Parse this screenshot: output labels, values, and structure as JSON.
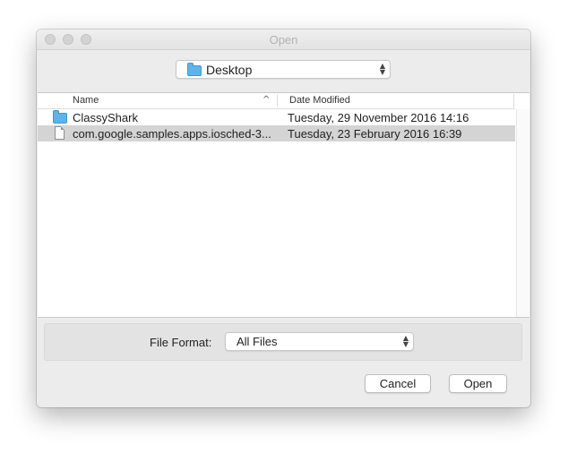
{
  "window": {
    "title": "Open"
  },
  "location": {
    "selected": "Desktop",
    "icon": "folder-icon"
  },
  "columns": {
    "name": "Name",
    "date_modified": "Date Modified",
    "sort_indicator": "^"
  },
  "files": [
    {
      "name": "ClassyShark",
      "date": "Tuesday, 29 November 2016 14:16",
      "icon": "folder-icon",
      "selected": false
    },
    {
      "name": "com.google.samples.apps.iosched-3...",
      "date": "Tuesday, 23 February 2016 16:39",
      "icon": "document-icon",
      "selected": true
    }
  ],
  "format": {
    "label": "File Format:",
    "selected": "All Files"
  },
  "buttons": {
    "cancel": "Cancel",
    "open": "Open"
  },
  "colors": {
    "folder": "#5fb3ea",
    "selection": "#d4d4d4",
    "window_background": "#ececec"
  }
}
